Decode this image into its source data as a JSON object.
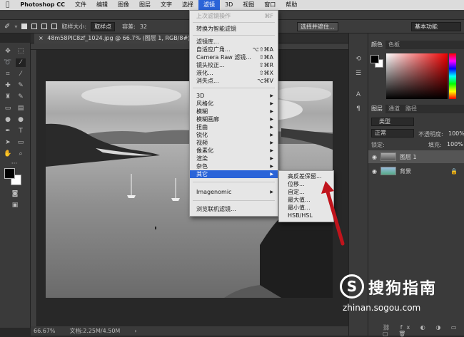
{
  "menubar": {
    "apple": "",
    "app": "Photoshop CC",
    "items": [
      "文件",
      "编辑",
      "图像",
      "图层",
      "文字",
      "选择",
      "滤镜",
      "3D",
      "视图",
      "窗口",
      "帮助"
    ],
    "active_index": 6
  },
  "options": {
    "sample_size_label": "取样大小:",
    "sample_size_value": "取样点",
    "tolerance_label": "容差:",
    "tolerance_value": "32",
    "refine_button": "选择并遮住...",
    "workspace": "基本功能"
  },
  "document": {
    "tab_title": "48m58PIC8zf_1024.jpg @ 66.7% (图层 1, RGB/8#) *"
  },
  "status": {
    "zoom": "66.67%",
    "doc_size": "文档:2.25M/4.50M"
  },
  "filter_menu": {
    "last_filter": "上次滤镜操作",
    "last_filter_shortcut": "⌘F",
    "convert_smart": "转换为智能滤镜",
    "gallery": "滤镜库...",
    "adaptive_wide": "自适应广角...",
    "adaptive_wide_shortcut": "⌥⇧⌘A",
    "camera_raw": "Camera Raw 滤镜...",
    "camera_raw_shortcut": "⇧⌘A",
    "lens_correction": "镜头校正...",
    "lens_correction_shortcut": "⇧⌘R",
    "liquify": "液化...",
    "liquify_shortcut": "⇧⌘X",
    "vanishing_point": "消失点...",
    "vanishing_point_shortcut": "⌥⌘V",
    "groups": [
      "3D",
      "风格化",
      "模糊",
      "模糊画廊",
      "扭曲",
      "锐化",
      "视频",
      "像素化",
      "渲染",
      "杂色",
      "其它"
    ],
    "imagenomic": "Imagenomic",
    "browse_online": "浏览联机滤镜..."
  },
  "other_submenu": {
    "items": [
      "高反差保留...",
      "位移...",
      "自定...",
      "最大值...",
      "最小值...",
      "HSB/HSL"
    ]
  },
  "color_panel": {
    "tabs": [
      "颜色",
      "色板"
    ]
  },
  "layers_panel": {
    "tabs": [
      "图层",
      "通道",
      "路径"
    ],
    "kind_filter": "类型",
    "blend_mode": "正常",
    "opacity_label": "不透明度:",
    "opacity_value": "100%",
    "lock_label": "锁定:",
    "fill_label": "填充:",
    "fill_value": "100%",
    "layers": [
      {
        "name": "图层 1",
        "selected": true
      },
      {
        "name": "背景",
        "selected": false
      }
    ]
  },
  "watermark": {
    "brand": "搜狗指南",
    "url": "zhinan.sogou.com"
  },
  "colors": {
    "menu_highlight": "#2b64d8",
    "arrow": "#c0141c"
  }
}
